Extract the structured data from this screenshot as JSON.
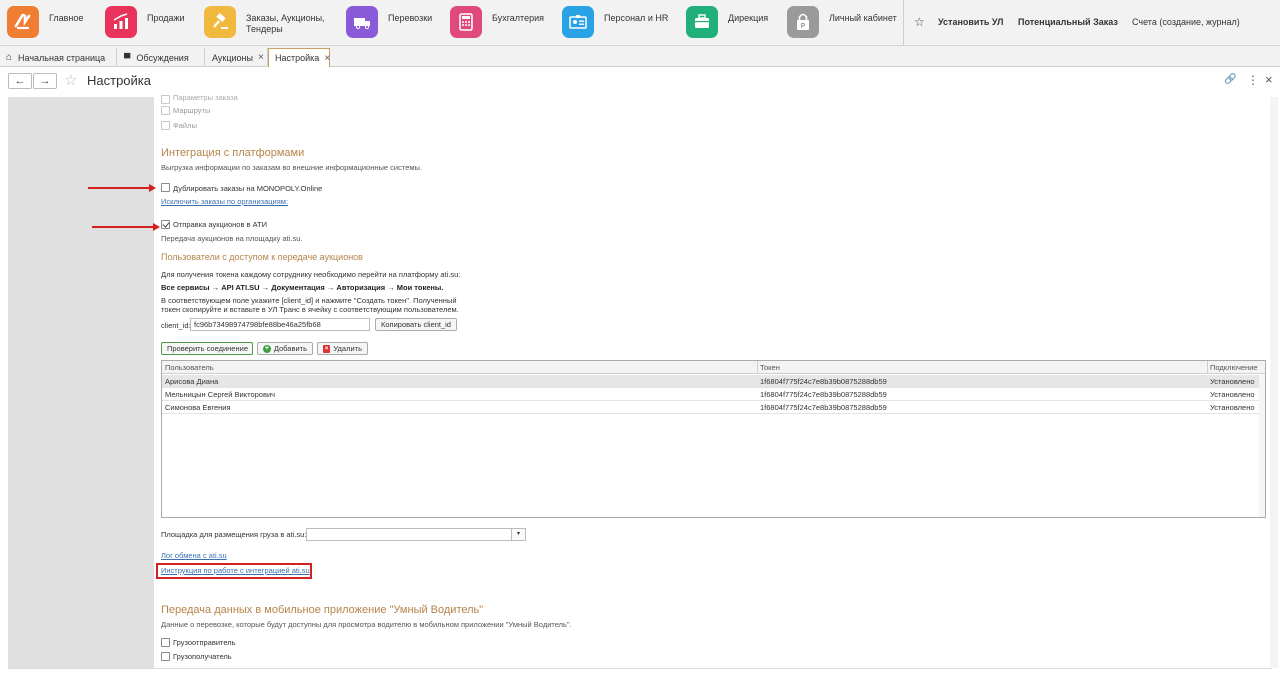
{
  "apps": [
    {
      "label": "Главное",
      "icon": "main-logo-icon",
      "color": "#ef7d32"
    },
    {
      "label": "Продажи",
      "icon": "sales-chart-icon",
      "color": "#e8345a"
    },
    {
      "label": "Заказы, Аукционы,\nТендеры",
      "icon": "gavel-icon",
      "color": "#f0b83c"
    },
    {
      "label": "Перевозки",
      "icon": "truck-icon",
      "color": "#8a5ad8"
    },
    {
      "label": "Бухгалтерия",
      "icon": "calculator-icon",
      "color": "#e04a7a"
    },
    {
      "label": "Персонал и HR",
      "icon": "id-card-icon",
      "color": "#2aa2e6"
    },
    {
      "label": "Дирекция",
      "icon": "briefcase-icon",
      "color": "#22b07a"
    },
    {
      "label": "Личный кабинет",
      "icon": "parking-lock-icon",
      "color": "#9a9a9a"
    }
  ],
  "top_actions": {
    "install": "Установить УЛ",
    "potential": "Потенциальный Заказ",
    "accounts": "Счета (создание, журнал)"
  },
  "tabs": [
    {
      "label": "Начальная страница"
    },
    {
      "label": "Обсуждения"
    },
    {
      "label": "Аукционы",
      "close": "×"
    },
    {
      "label": "Настройка",
      "close": "×"
    }
  ],
  "page": {
    "back": "←",
    "forward": "→",
    "star": "☆",
    "title": "Настройка",
    "link_icon": "🔗",
    "more": "⋮",
    "close": "×"
  },
  "top_checks": [
    "Параметры заказа",
    "Маршруты",
    "Файлы"
  ],
  "integration": {
    "title": "Интеграция с платформами",
    "description": "Выгрузка информации по заказам во внешние информационные системы.",
    "duplicate_label": "Дублировать заказы на MONOPOLY.Online",
    "exclude_link": "Исключить заказы по организациям:",
    "ati_label": "Отправка аукционов в АТИ",
    "ati_desc": "Передача аукционов на площадку ati.su."
  },
  "users_section": {
    "title": "Пользователи с доступом к передаче аукционов",
    "line1": "Для получения токена каждому сотруднику необходимо перейти на платформу ati.su:",
    "path": "Все сервисы → API ATI.SU → Документация → Авторизация → Мои токены.",
    "line2": "В соответствующем поле укажите [client_id]  и нажмите \"Создать токен\". Полученный",
    "line3": "токен скопируйте и вставьте в УЛ Транс в ячейку с соответствующим пользователем.",
    "client_id_label": "client_id:",
    "client_id_value": "fc96b73498974798bfe88be46a25fb68",
    "copy_button": "Копировать client_id"
  },
  "actions": {
    "check": "Проверить соединение",
    "add": "Добавить",
    "delete": "Удалить"
  },
  "table": {
    "headers": [
      "Пользователь",
      "Токен",
      "Подключение"
    ],
    "rows": [
      [
        "Арисова Диана",
        "1f6804f775f24c7e8b39b0875288db59",
        "Установлено"
      ],
      [
        "Мельницын Сергей Викторович",
        "1f6804f775f24c7e8b39b0875288db59",
        "Установлено"
      ],
      [
        "Симонова Евгения",
        "1f6804f775f24c7e8b39b0875288db59",
        "Установлено"
      ]
    ]
  },
  "placement": {
    "label": "Площадка для размещения груза в ati.su:",
    "value": "",
    "dropdown": "▾"
  },
  "links": {
    "log": "Лог обмена с ati.su",
    "instruction": "Инструкция по работе с интеграцией ati.su"
  },
  "mobile": {
    "title": "Передача данных в мобильное приложение \"Умный Водитель\"",
    "description": "Данные о перевозке, которые будут доступны для просмотра водителю в мобильном приложении \"Умный Водитель\".",
    "items": [
      "Грузоотправитель",
      "Грузополучатель"
    ]
  }
}
